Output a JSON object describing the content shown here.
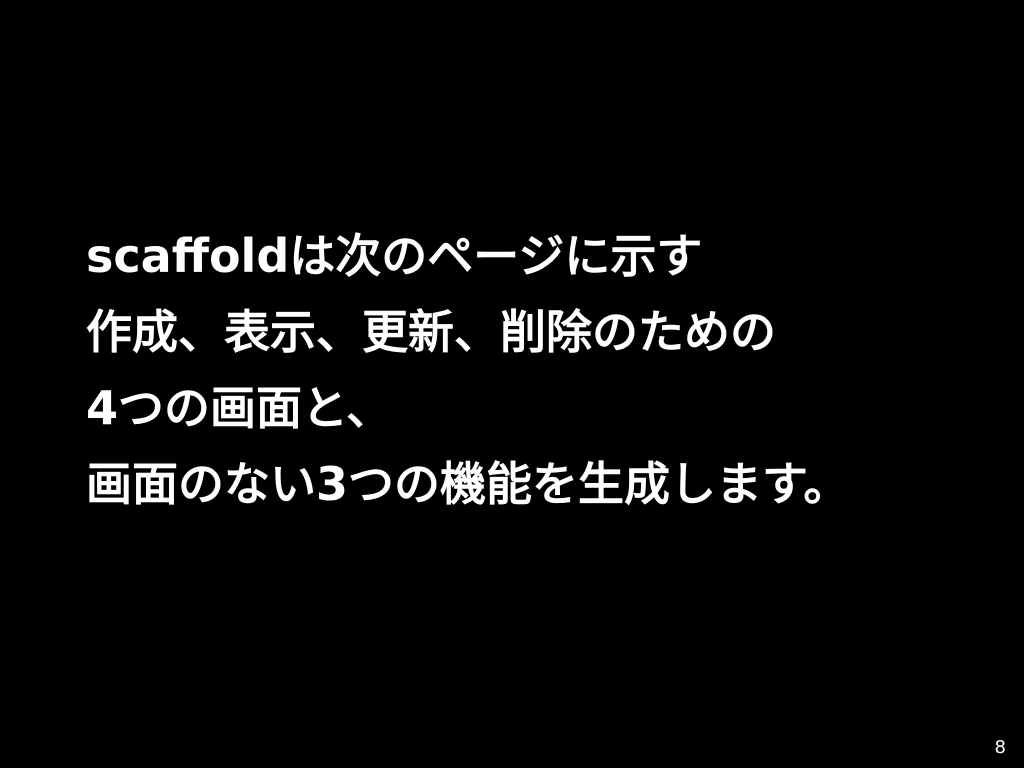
{
  "slide": {
    "lines": [
      "scaffoldは次のページに示す",
      "作成、表示、更新、削除のための",
      "4つの画面と、",
      "画面のない3つの機能を生成します。"
    ],
    "page_number": "8"
  },
  "colors": {
    "background": "#000000",
    "text": "#ffffff"
  }
}
